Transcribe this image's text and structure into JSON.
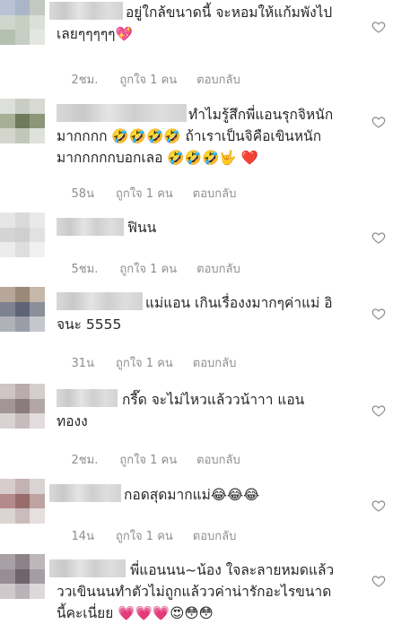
{
  "comments": [
    {
      "text_lines": [
        "อยู่ใกล้ขนาดนี้ จะหอมให้แก้มพังไป",
        "เลยๆๆๆๆๆ💖"
      ],
      "time": "2ชม.",
      "likes": "ถูกใจ 1 คน",
      "reply": "ตอบกลับ"
    },
    {
      "text_lines": [
        "ทำไมรู้สึกพี่แอนรุกจิหนัก",
        "มากกกก 🤣🤣🤣🤣 ถ้าเราเป็นจิคือเขินหนัก",
        "มากกกกกบอกเลอ 🤣🤣🤣🤟 ❤️"
      ],
      "time": "58น",
      "likes": "ถูกใจ 1 คน",
      "reply": "ตอบกลับ"
    },
    {
      "text_lines": [
        "ฟินน"
      ],
      "time": "5ชม.",
      "likes": "ถูกใจ 1 คน",
      "reply": "ตอบกลับ"
    },
    {
      "text_lines": [
        "แม่แอน เกินเรื่องงมากๆค่าแม่ อิ",
        "จนะ 5555"
      ],
      "time": "31น",
      "likes": "ถูกใจ 1 คน",
      "reply": "ตอบกลับ"
    },
    {
      "text_lines": [
        "กรี๊ด จะไม่ไหวแล้ววน้าาา แอน",
        "ทองง"
      ],
      "time": "2ชม.",
      "likes": "ถูกใจ 1 คน",
      "reply": "ตอบกลับ"
    },
    {
      "text_lines": [
        "กอดสุดมากแม่😂😂😂"
      ],
      "time": "14น",
      "likes": "ถูกใจ 1 คน",
      "reply": "ตอบกลับ"
    },
    {
      "text_lines": [
        "พี่แอนนน~น้อง ใจละลายหมดแล้ว",
        "ววเขินนนทำตัวไม่ถูกแล้ววค่าน่ารักอะไรขนาด",
        "นี้คะเนี่ยย 💗💗💗😍😳😳"
      ]
    }
  ],
  "icons": {
    "like": "heart-outline-icon"
  },
  "colors": {
    "text": "#262626",
    "meta": "#8e8e8e",
    "heart": "#8e8e8e"
  }
}
